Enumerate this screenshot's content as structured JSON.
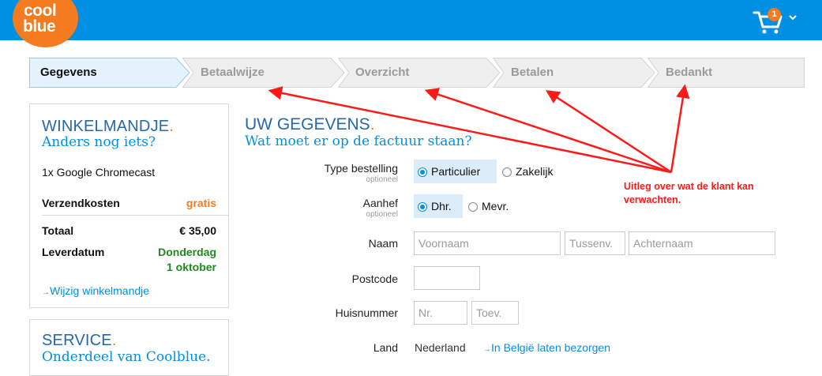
{
  "header": {
    "logo_line1": "cool",
    "logo_line2": "blue",
    "cart_count": "1"
  },
  "steps": [
    {
      "label": "Gegevens",
      "active": true
    },
    {
      "label": "Betaalwijze",
      "active": false
    },
    {
      "label": "Overzicht",
      "active": false
    },
    {
      "label": "Betalen",
      "active": false
    },
    {
      "label": "Bedankt",
      "active": false
    }
  ],
  "cart_panel": {
    "title": "WINKELMANDJE",
    "dot": ".",
    "subtitle": "Anders nog iets?",
    "item": "1x Google Chromecast",
    "shipping_label": "Verzendkosten",
    "shipping_value": "gratis",
    "total_label": "Totaal",
    "total_value": "€ 35,00",
    "delivery_label": "Leverdatum",
    "delivery_value_line1": "Donderdag",
    "delivery_value_line2": "1 oktober",
    "edit_link": "Wijzig winkelmandje"
  },
  "service_panel": {
    "title": "SERVICE",
    "dot": ".",
    "subtitle": "Onderdeel van Coolblue."
  },
  "form": {
    "title": "UW GEGEVENS",
    "dot": ".",
    "subtitle": "Wat moet er op de factuur staan?",
    "order_type_label": "Type bestelling",
    "order_type_optional": "optioneel",
    "order_type_options": [
      "Particulier",
      "Zakelijk"
    ],
    "salutation_label": "Aanhef",
    "salutation_optional": "optioneel",
    "salutation_options": [
      "Dhr.",
      "Mevr."
    ],
    "name_label": "Naam",
    "first_name_placeholder": "Voornaam",
    "infix_placeholder": "Tussenv.",
    "last_name_placeholder": "Achternaam",
    "postcode_label": "Postcode",
    "house_number_label": "Huisnummer",
    "house_number_placeholder": "Nr.",
    "addition_placeholder": "Toev.",
    "country_label": "Land",
    "country_value": "Nederland",
    "country_link": "In België laten bezorgen"
  },
  "annotation": {
    "line1": "Uitleg over wat de klant kan",
    "line2": "verwachten."
  },
  "colors": {
    "header_blue": "#0090e3",
    "brand_orange": "#f47b20",
    "title_blue": "#2668a8",
    "green": "#1f8a1f",
    "annotation_red": "#ff1a1a"
  }
}
